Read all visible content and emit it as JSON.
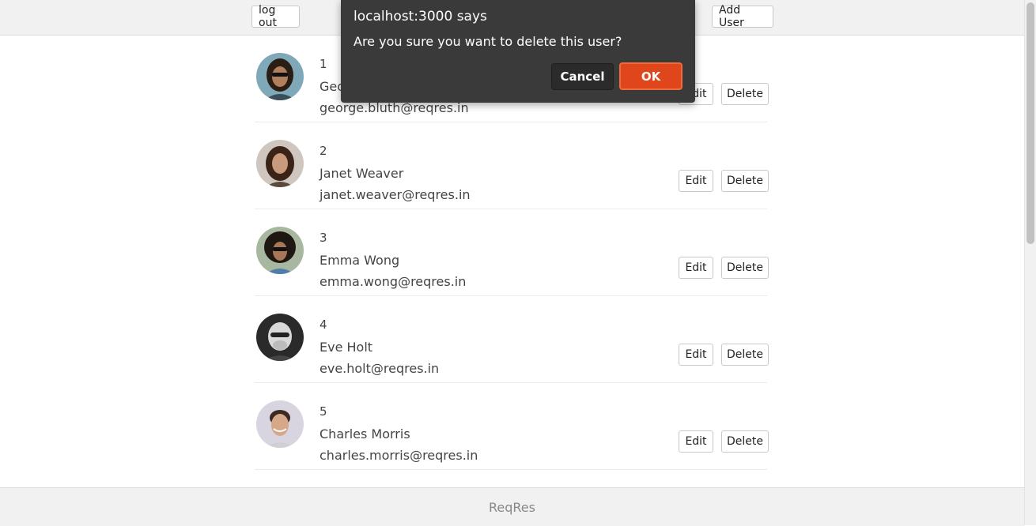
{
  "header": {
    "logout_label": "log out",
    "add_user_label": "Add User"
  },
  "users": [
    {
      "id": "1",
      "name": "George Bluth",
      "email": "george.bluth@reqres.in",
      "edit": "Edit",
      "delete": "Delete"
    },
    {
      "id": "2",
      "name": "Janet Weaver",
      "email": "janet.weaver@reqres.in",
      "edit": "Edit",
      "delete": "Delete"
    },
    {
      "id": "3",
      "name": "Emma Wong",
      "email": "emma.wong@reqres.in",
      "edit": "Edit",
      "delete": "Delete"
    },
    {
      "id": "4",
      "name": "Eve Holt",
      "email": "eve.holt@reqres.in",
      "edit": "Edit",
      "delete": "Delete"
    },
    {
      "id": "5",
      "name": "Charles Morris",
      "email": "charles.morris@reqres.in",
      "edit": "Edit",
      "delete": "Delete"
    }
  ],
  "footer": {
    "text": "ReqRes"
  },
  "dialog": {
    "title": "localhost:3000 says",
    "message": "Are you sure you want to delete this user?",
    "cancel_label": "Cancel",
    "ok_label": "OK"
  },
  "colors": {
    "ok_button": "#e0461b",
    "dialog_bg": "#3a3a3a"
  }
}
